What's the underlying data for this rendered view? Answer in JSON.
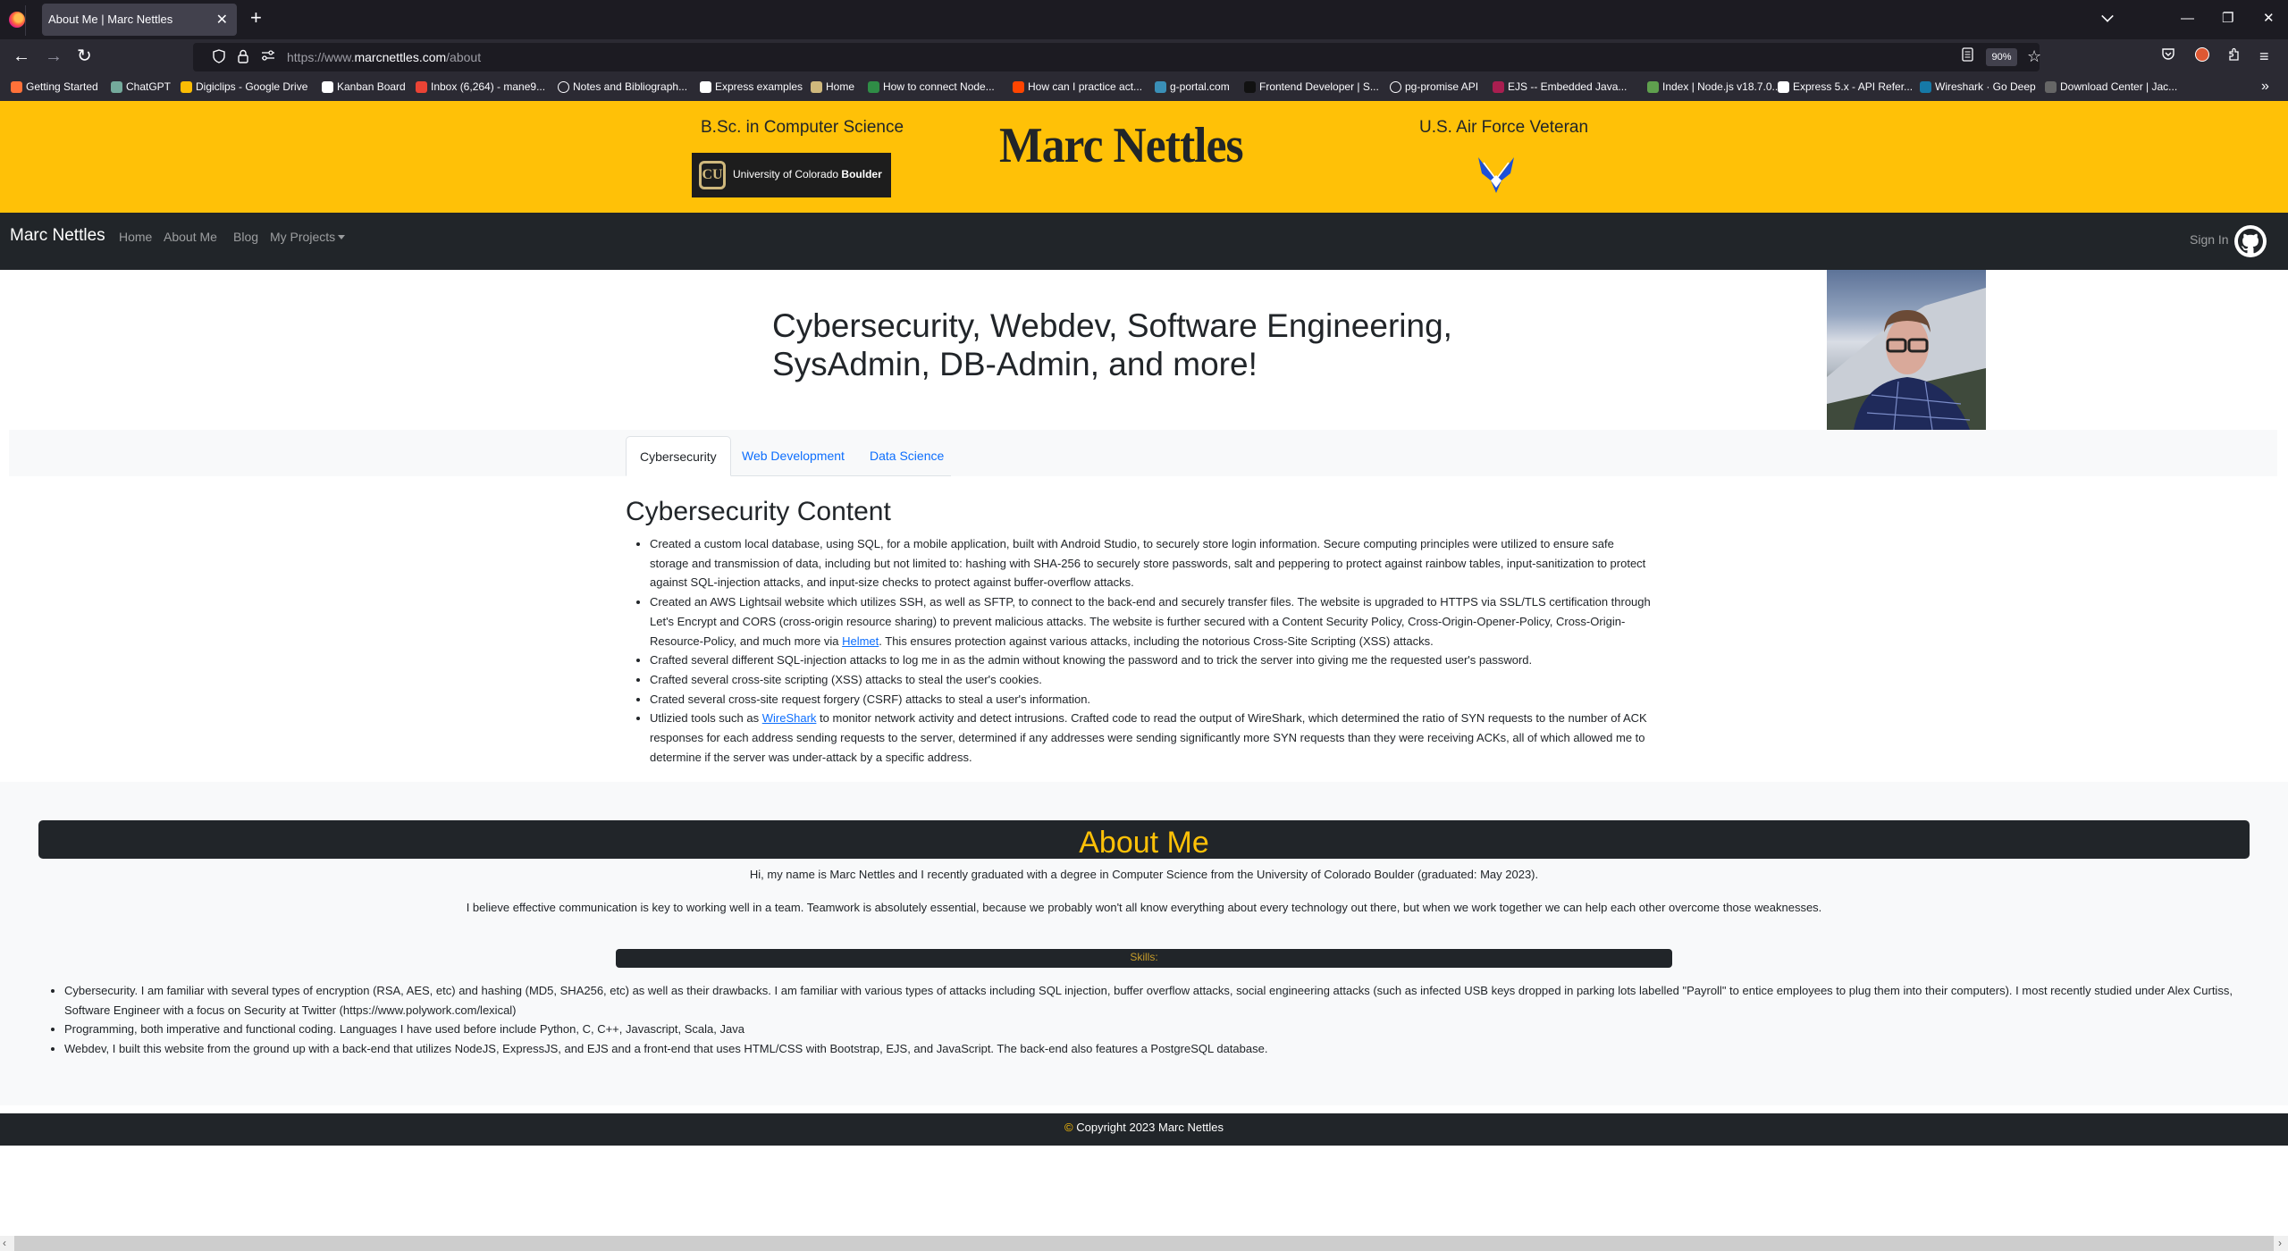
{
  "browser": {
    "tab_title": "About Me | Marc Nettles",
    "tab_close": "✕",
    "new_tab": "+",
    "url_scheme": "https://www.",
    "url_host": "marcnettles.com",
    "url_path": "/about",
    "zoom_level": "90%",
    "window_controls": {
      "minimize": "—",
      "restore": "❐",
      "close": "✕"
    },
    "nav": {
      "back": "←",
      "forward": "→",
      "reload": "↻"
    },
    "icons": [
      "shield-icon",
      "lock-icon",
      "permissions-icon",
      "reader-view-icon",
      "bookmark-star-icon",
      "pocket-icon",
      "duckduckgo-icon",
      "extensions-icon",
      "menu-icon"
    ]
  },
  "bookmarks": [
    {
      "label": "Getting Started",
      "icon": "firefox-icon",
      "color": "#ff7139"
    },
    {
      "label": "ChatGPT",
      "icon": "chatgpt-icon",
      "color": "#74aa9c"
    },
    {
      "label": "Digiclips - Google Drive",
      "icon": "google-drive-icon",
      "color": "#fbbc04"
    },
    {
      "label": "Kanban Board",
      "icon": "notion-icon",
      "color": "#ffffff"
    },
    {
      "label": "Inbox (6,264) - mane9...",
      "icon": "gmail-icon",
      "color": "#ea4335"
    },
    {
      "label": "Notes and Bibliograph...",
      "icon": "globe-icon",
      "color": "#2b2a33"
    },
    {
      "label": "Express examples",
      "icon": "express-icon",
      "color": "#ffffff"
    },
    {
      "label": "Home",
      "icon": "cu-icon",
      "color": "#cfb87c"
    },
    {
      "label": "How to connect Node...",
      "icon": "geeksforgeeks-icon",
      "color": "#2f8d46"
    },
    {
      "label": "How can I practice act...",
      "icon": "reddit-icon",
      "color": "#ff4500"
    },
    {
      "label": "g-portal.com",
      "icon": "gportal-icon",
      "color": "#3a8fb7"
    },
    {
      "label": "Frontend Developer | S...",
      "icon": "page-icon",
      "color": "#111111"
    },
    {
      "label": "pg-promise API",
      "icon": "globe-icon",
      "color": "#2b2a33"
    },
    {
      "label": "EJS -- Embedded Java...",
      "icon": "ejs-icon",
      "color": "#a91e50"
    },
    {
      "label": "Index | Node.js v18.7.0...",
      "icon": "nodejs-icon",
      "color": "#5fa04e"
    },
    {
      "label": "Express 5.x - API Refer...",
      "icon": "express-icon",
      "color": "#ffffff"
    },
    {
      "label": "Wireshark · Go Deep",
      "icon": "wireshark-icon",
      "color": "#1679a7"
    },
    {
      "label": "Download Center | Jac...",
      "icon": "jack-icon",
      "color": "#666666"
    }
  ],
  "bookmarks_overflow": "»",
  "header": {
    "degree": "B.Sc. in Computer Science",
    "university_logo_text": "University of Colorado",
    "university_logo_bold": "Boulder",
    "site_title": "Marc Nettles",
    "veteran": "U.S. Air Force Veteran"
  },
  "navbar": {
    "brand": "Marc Nettles",
    "links": [
      "Home",
      "About Me",
      "Blog",
      "My Projects"
    ],
    "sign_in": "Sign In"
  },
  "hero": {
    "heading_line1": "Cybersecurity, Webdev, Software Engineering,",
    "heading_line2": "SysAdmin, DB-Admin, and more!"
  },
  "tabs": [
    {
      "label": "Cybersecurity",
      "active": true
    },
    {
      "label": "Web Development",
      "active": false
    },
    {
      "label": "Data Science",
      "active": false
    }
  ],
  "content": {
    "heading": "Cybersecurity Content",
    "items": [
      "Created a custom local database, using SQL, for a mobile application, built with Android Studio, to securely store login information. Secure computing principles were utilized to ensure safe storage and transmission of data, including but not limited to: hashing with SHA-256 to securely store passwords, salt and peppering to protect against rainbow tables, input-sanitization to protect against SQL-injection attacks, and input-size checks to protect against buffer-overflow attacks.",
      {
        "before": "Created an AWS Lightsail website which utilizes SSH, as well as SFTP, to connect to the back-end and securely transfer files. The website is upgraded to HTTPS via SSL/TLS certification through Let's Encrypt and CORS (cross-origin resource sharing) to prevent malicious attacks. The website is further secured with a Content Security Policy, Cross-Origin-Opener-Policy, Cross-Origin-Resource-Policy, and much more via ",
        "link": "Helmet",
        "after": ". This ensures protection against various attacks, including the notorious Cross-Site Scripting (XSS) attacks."
      },
      "Crafted several different SQL-injection attacks to log me in as the admin without knowing the password and to trick the server into giving me the requested user's password.",
      "Crafted several cross-site scripting (XSS) attacks to steal the user's cookies.",
      "Crated several cross-site request forgery (CSRF) attacks to steal a user's information.",
      {
        "before": "Utlizied tools such as ",
        "link": "WireShark",
        "after": " to monitor network activity and detect intrusions. Crafted code to read the output of WireShark, which determined the ratio of SYN requests to the number of ACK responses for each address sending requests to the server, determined if any addresses were sending significantly more SYN requests than they were receiving ACKs, all of which allowed me to determine if the server was under-attack by a specific address."
      }
    ]
  },
  "about": {
    "title": "About Me",
    "intro": "Hi, my name is Marc Nettles and I recently graduated with a degree in Computer Science from the University of Colorado Boulder (graduated: May 2023).",
    "teamwork": "I believe effective communication is key to working well in a team. Teamwork is absolutely essential, because we probably won't all know everything about every technology out there, but when we work together we can help each other overcome those weaknesses.",
    "skills_label": "Skills:",
    "skills": [
      "Cybersecurity. I am familiar with several types of encryption (RSA, AES, etc) and hashing (MD5, SHA256, etc) as well as their drawbacks. I am familiar with various types of attacks including SQL injection, buffer overflow attacks, social engineering attacks (such as infected USB keys dropped in parking lots labelled \"Payroll\" to entice employees to plug them into their computers). I most recently studied under Alex Curtiss, Software Engineer with a focus on Security at Twitter (https://www.polywork.com/lexical)",
      "Programming, both imperative and functional coding. Languages I have used before include Python, C, C++, Javascript, Scala, Java",
      "Webdev, I built this website from the ground up with a back-end that utilizes NodeJS, ExpressJS, and EJS and a front-end that uses HTML/CSS with Bootstrap, EJS, and JavaScript. The back-end also features a PostgreSQL database."
    ]
  },
  "footer": {
    "copyright_symbol": "©",
    "copyright_text": " Copyright 2023 Marc Nettles"
  },
  "colors": {
    "accent_yellow": "#ffc107",
    "dark": "#212529",
    "link_blue": "#0d6efd",
    "light_bg": "#f8f9fa"
  }
}
